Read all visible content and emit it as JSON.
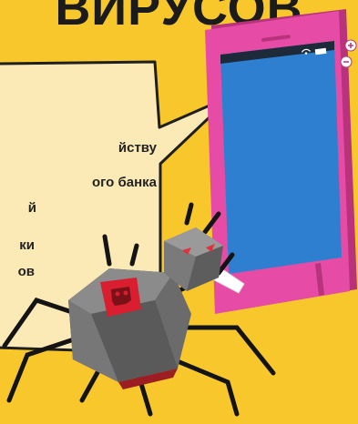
{
  "headline": {
    "text": "ВИРУСОВ"
  },
  "bubble": {
    "lines": [
      "йству",
      "ого банка",
      "й",
      "ки",
      "ов"
    ]
  },
  "phone": {
    "status_icons": [
      "wifi-icon",
      "battery-icon"
    ],
    "side_buttons": [
      "plus-button",
      "minus-button"
    ]
  },
  "colors": {
    "background": "#f7c72c",
    "phone_body": "#e64ba6",
    "phone_screen": "#2f7fd1",
    "bubble_fill": "#fbe9b6",
    "bubble_stroke": "#1f1f1f",
    "spider_body": "#7a7a7a",
    "spider_skull": "#d81e2f"
  }
}
